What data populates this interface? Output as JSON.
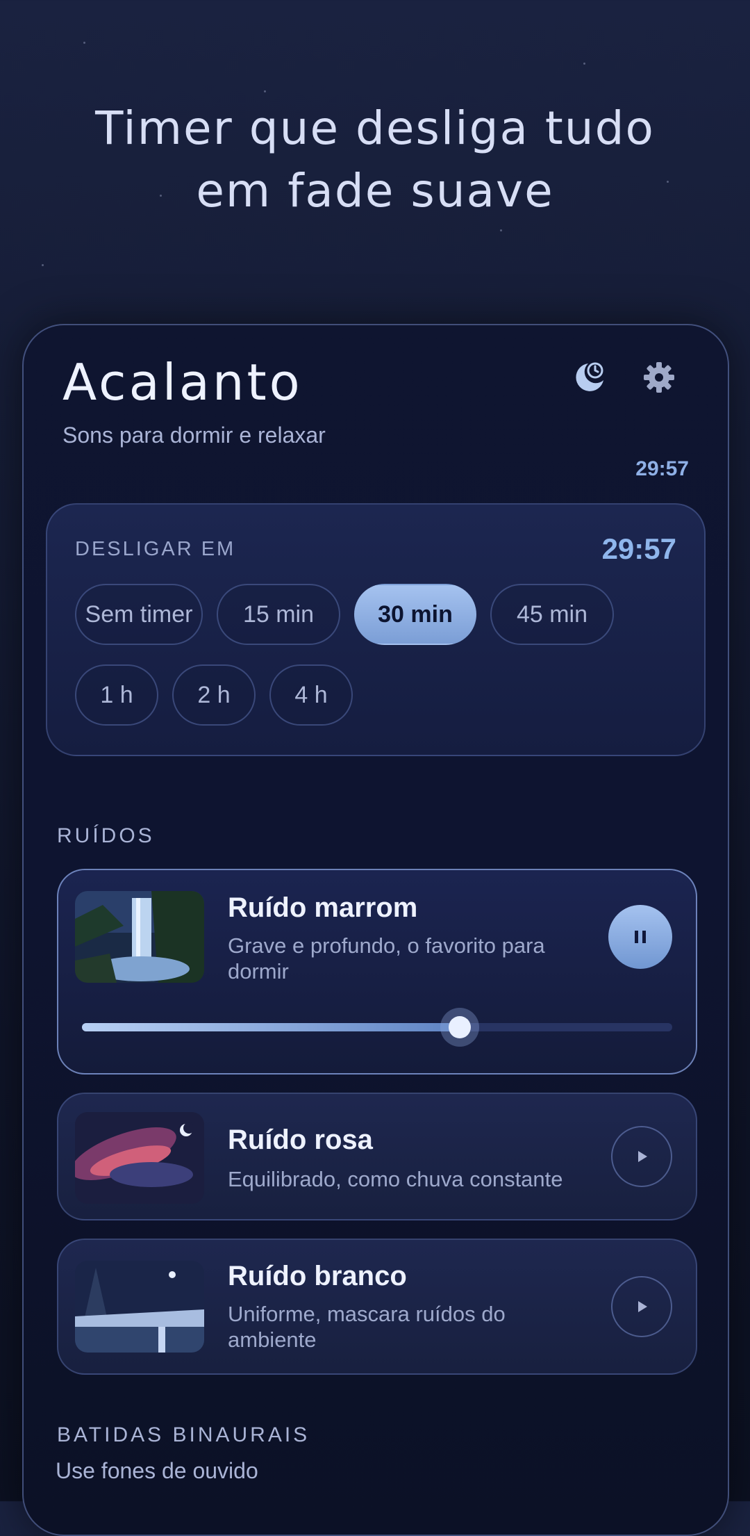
{
  "hero": {
    "line1": "Timer que desliga tudo",
    "line2": "em fade suave"
  },
  "app": {
    "title": "Acalanto",
    "subtitle": "Sons para dormir e relaxar",
    "elapsed_time": "29:57",
    "icons": {
      "moon": "moon-clock-icon",
      "settings": "gear-icon"
    }
  },
  "timer": {
    "label": "DESLIGAR EM",
    "countdown": "29:57",
    "options": [
      "Sem timer",
      "15 min",
      "30 min",
      "45 min",
      "1 h",
      "2 h",
      "4 h"
    ],
    "selected": "30 min"
  },
  "noises": {
    "section_label": "RUÍDOS",
    "items": [
      {
        "title": "Ruído marrom",
        "description": "Grave e profundo, o favorito para dormir",
        "state": "playing",
        "volume": 0.64,
        "thumbnail": "waterfall-night-image"
      },
      {
        "title": "Ruído rosa",
        "description": "Equilibrado, como chuva constante",
        "state": "paused",
        "thumbnail": "pink-nebula-image"
      },
      {
        "title": "Ruído branco",
        "description": "Uniforme, mascara ruídos do ambiente",
        "state": "paused",
        "thumbnail": "snowy-lake-image"
      }
    ]
  },
  "binaural": {
    "section_label": "BATIDAS BINAURAIS",
    "subtitle": "Use fones de ouvido"
  },
  "colors": {
    "accent": "#8fb6ec",
    "background": "#151c35",
    "card": "#1c2650"
  }
}
